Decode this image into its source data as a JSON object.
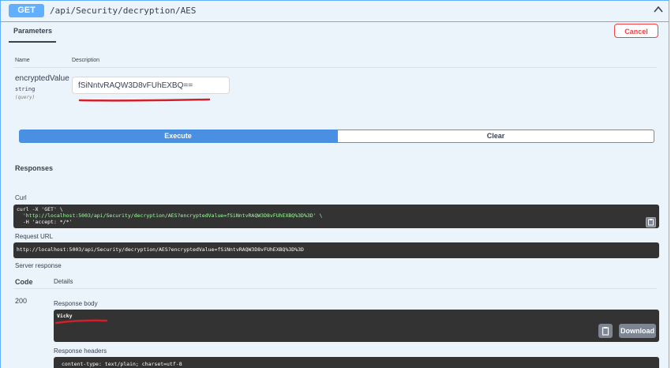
{
  "summary": {
    "method": "GET",
    "path": "/api/Security/decryption/AES"
  },
  "parameters": {
    "tab_label": "Parameters",
    "cancel_label": "Cancel",
    "col_name": "Name",
    "col_description": "Description",
    "items": [
      {
        "name": "encryptedValue",
        "type": "string",
        "in": "(query)",
        "value": "fSiNntvRAQW3D8vFUhEXBQ=="
      }
    ]
  },
  "actions": {
    "execute_label": "Execute",
    "clear_label": "Clear"
  },
  "responses": {
    "title": "Responses",
    "curl_label": "Curl",
    "curl_lines": [
      "curl -X 'GET' \\",
      "  'http://localhost:5003/api/Security/decryption/AES?encryptedValue=fSiNntvRAQW3D8vFUhEXBQ%3D%3D' \\",
      "  -H 'accept: */*'"
    ],
    "request_url_label": "Request URL",
    "request_url": "http://localhost:5003/api/Security/decryption/AES?encryptedValue=fSiNntvRAQW3D8vFUhEXBQ%3D%3D",
    "server_response_label": "Server response",
    "code_col": "Code",
    "details_col": "Details",
    "status_code": "200",
    "response_body_label": "Response body",
    "response_body": "Vicky",
    "download_label": "Download",
    "response_headers_label": "Response headers",
    "response_headers": "content-type: text/plain; charset=utf-8"
  },
  "icons": {
    "collapse": "chevron-up-icon",
    "copy": "clipboard-icon"
  },
  "colors": {
    "accent": "#61affe",
    "execute": "#4990e2",
    "danger": "#f93e3e",
    "annotation": "#d0202a"
  }
}
